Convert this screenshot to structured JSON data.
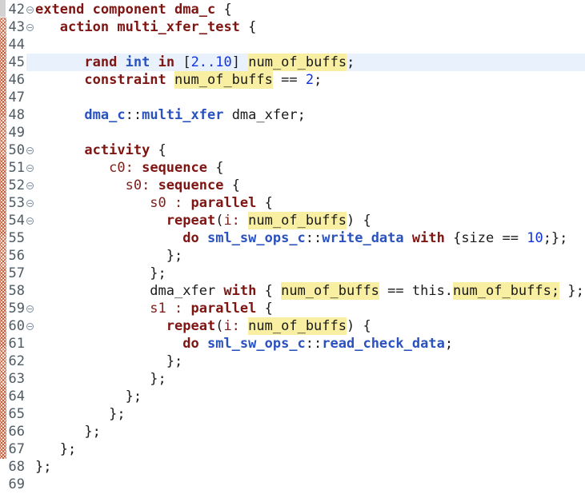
{
  "editor": {
    "colors": {
      "keyword": "#7f1512",
      "type_ref": "#2a52be",
      "number": "#1133dd",
      "label": "#7c211b",
      "text": "#1a1a1a",
      "line_number": "#4f5a62",
      "occurrence_highlight": "#f9efa2",
      "current_line": "#e8f1fc",
      "annotation_hatch": "#c75d38",
      "gutter_top": "#d2d2d2",
      "fold_border": "#7f8ea2"
    },
    "lines": [
      {
        "num": "42",
        "indent": 0,
        "fold": true,
        "current": false,
        "tokens": [
          [
            "kw",
            "extend"
          ],
          [
            "plain",
            " "
          ],
          [
            "kw",
            "component"
          ],
          [
            "plain",
            " "
          ],
          [
            "kw",
            "dma_c"
          ],
          [
            "plain",
            " {"
          ]
        ]
      },
      {
        "num": "43",
        "indent": 3,
        "fold": true,
        "current": false,
        "tokens": [
          [
            "kw",
            "action"
          ],
          [
            "plain",
            " "
          ],
          [
            "kw",
            "multi_xfer_test"
          ],
          [
            "plain",
            " {"
          ]
        ]
      },
      {
        "num": "44",
        "indent": 0,
        "fold": false,
        "current": false,
        "tokens": []
      },
      {
        "num": "45",
        "indent": 6,
        "fold": false,
        "current": true,
        "tokens": [
          [
            "kw",
            "rand"
          ],
          [
            "plain",
            " "
          ],
          [
            "type",
            "int"
          ],
          [
            "plain",
            " "
          ],
          [
            "kw",
            "in"
          ],
          [
            "plain",
            " ["
          ],
          [
            "num",
            "2..10"
          ],
          [
            "plain",
            "] "
          ],
          [
            "hl",
            "num_of_buffs"
          ],
          [
            "plain",
            ";"
          ]
        ]
      },
      {
        "num": "46",
        "indent": 6,
        "fold": false,
        "current": false,
        "tokens": [
          [
            "kw",
            "constraint"
          ],
          [
            "plain",
            " "
          ],
          [
            "hl",
            "num_of_buffs"
          ],
          [
            "plain",
            " == "
          ],
          [
            "num",
            "2"
          ],
          [
            "plain",
            ";"
          ]
        ]
      },
      {
        "num": "47",
        "indent": 0,
        "fold": false,
        "current": false,
        "tokens": []
      },
      {
        "num": "48",
        "indent": 6,
        "fold": false,
        "current": false,
        "tokens": [
          [
            "type",
            "dma_c"
          ],
          [
            "plain",
            "::"
          ],
          [
            "type",
            "multi_xfer"
          ],
          [
            "plain",
            " dma_xfer;"
          ]
        ]
      },
      {
        "num": "49",
        "indent": 0,
        "fold": false,
        "current": false,
        "tokens": []
      },
      {
        "num": "50",
        "indent": 6,
        "fold": true,
        "current": false,
        "tokens": [
          [
            "kw",
            "activity"
          ],
          [
            "plain",
            " {"
          ]
        ]
      },
      {
        "num": "51",
        "indent": 9,
        "fold": true,
        "current": false,
        "tokens": [
          [
            "label",
            "c0:"
          ],
          [
            "plain",
            " "
          ],
          [
            "kw",
            "sequence"
          ],
          [
            "plain",
            " {"
          ]
        ]
      },
      {
        "num": "52",
        "indent": 11,
        "fold": true,
        "current": false,
        "tokens": [
          [
            "label",
            "s0:"
          ],
          [
            "plain",
            " "
          ],
          [
            "kw",
            "sequence"
          ],
          [
            "plain",
            " {"
          ]
        ]
      },
      {
        "num": "53",
        "indent": 14,
        "fold": true,
        "current": false,
        "tokens": [
          [
            "label",
            "s0 :"
          ],
          [
            "plain",
            " "
          ],
          [
            "kw",
            "parallel"
          ],
          [
            "plain",
            " {"
          ]
        ]
      },
      {
        "num": "54",
        "indent": 16,
        "fold": true,
        "current": false,
        "tokens": [
          [
            "kw",
            "repeat"
          ],
          [
            "plain",
            "("
          ],
          [
            "label",
            "i:"
          ],
          [
            "plain",
            " "
          ],
          [
            "hl",
            "num_of_buffs"
          ],
          [
            "plain",
            ") {"
          ]
        ]
      },
      {
        "num": "55",
        "indent": 18,
        "fold": false,
        "current": false,
        "tokens": [
          [
            "kw",
            "do"
          ],
          [
            "plain",
            " "
          ],
          [
            "type",
            "sml_sw_ops_c"
          ],
          [
            "plain",
            "::"
          ],
          [
            "type",
            "write_data"
          ],
          [
            "plain",
            " "
          ],
          [
            "kw",
            "with"
          ],
          [
            "plain",
            " {size == "
          ],
          [
            "num",
            "10"
          ],
          [
            "plain",
            ";};"
          ]
        ]
      },
      {
        "num": "56",
        "indent": 16,
        "fold": false,
        "current": false,
        "tokens": [
          [
            "plain",
            "};"
          ]
        ]
      },
      {
        "num": "57",
        "indent": 14,
        "fold": false,
        "current": false,
        "tokens": [
          [
            "plain",
            "};"
          ]
        ]
      },
      {
        "num": "58",
        "indent": 14,
        "fold": false,
        "current": false,
        "tokens": [
          [
            "plain",
            "dma_xfer "
          ],
          [
            "kw",
            "with"
          ],
          [
            "plain",
            " { "
          ],
          [
            "hl",
            "num_of_buffs"
          ],
          [
            "plain",
            " == this."
          ],
          [
            "hl",
            "num_of_buffs;"
          ],
          [
            "plain",
            " };"
          ]
        ]
      },
      {
        "num": "59",
        "indent": 14,
        "fold": true,
        "current": false,
        "tokens": [
          [
            "label",
            "s1 :"
          ],
          [
            "plain",
            " "
          ],
          [
            "kw",
            "parallel"
          ],
          [
            "plain",
            " {"
          ]
        ]
      },
      {
        "num": "60",
        "indent": 16,
        "fold": true,
        "current": false,
        "tokens": [
          [
            "kw",
            "repeat"
          ],
          [
            "plain",
            "("
          ],
          [
            "label",
            "i:"
          ],
          [
            "plain",
            " "
          ],
          [
            "hl",
            "num_of_buffs"
          ],
          [
            "plain",
            ") {"
          ]
        ]
      },
      {
        "num": "61",
        "indent": 18,
        "fold": false,
        "current": false,
        "tokens": [
          [
            "kw",
            "do"
          ],
          [
            "plain",
            " "
          ],
          [
            "type",
            "sml_sw_ops_c"
          ],
          [
            "plain",
            "::"
          ],
          [
            "type",
            "read_check_data"
          ],
          [
            "plain",
            ";"
          ]
        ]
      },
      {
        "num": "62",
        "indent": 16,
        "fold": false,
        "current": false,
        "tokens": [
          [
            "plain",
            "};"
          ]
        ]
      },
      {
        "num": "63",
        "indent": 14,
        "fold": false,
        "current": false,
        "tokens": [
          [
            "plain",
            "};"
          ]
        ]
      },
      {
        "num": "64",
        "indent": 11,
        "fold": false,
        "current": false,
        "tokens": [
          [
            "plain",
            "};"
          ]
        ]
      },
      {
        "num": "65",
        "indent": 9,
        "fold": false,
        "current": false,
        "tokens": [
          [
            "plain",
            "};"
          ]
        ]
      },
      {
        "num": "66",
        "indent": 6,
        "fold": false,
        "current": false,
        "tokens": [
          [
            "plain",
            "};"
          ]
        ]
      },
      {
        "num": "67",
        "indent": 3,
        "fold": false,
        "current": false,
        "tokens": [
          [
            "plain",
            "};"
          ]
        ]
      },
      {
        "num": "68",
        "indent": 0,
        "fold": false,
        "current": false,
        "tokens": [
          [
            "plain",
            "};"
          ]
        ]
      },
      {
        "num": "69",
        "indent": 0,
        "fold": false,
        "current": false,
        "tokens": []
      }
    ]
  }
}
